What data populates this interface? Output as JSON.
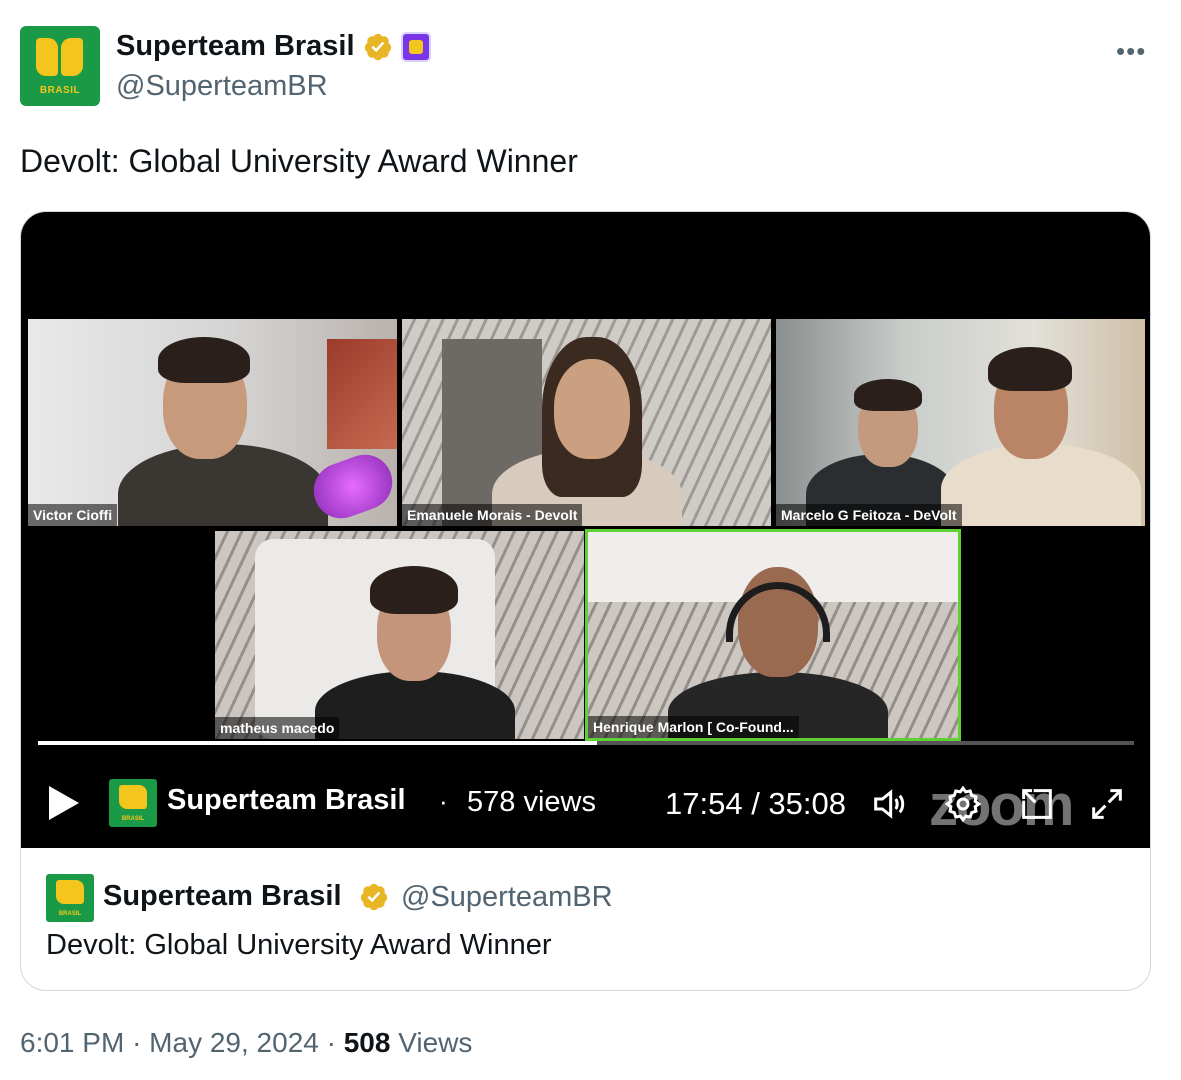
{
  "author": {
    "display_name": "Superteam Brasil",
    "handle": "@SuperteamBR",
    "avatar_text": "BRASIL",
    "verified_icon": "gold-verified-badge-icon",
    "affiliation_icon": "superteam-affiliate-badge-icon"
  },
  "tweet": {
    "text": "Devolt: Global University Award Winner"
  },
  "video": {
    "participants": [
      {
        "label": "Victor Cioffi"
      },
      {
        "label": "Emanuele Morais - Devolt"
      },
      {
        "label": "Marcelo G Feitoza - DeVolt"
      },
      {
        "label": "matheus macedo"
      },
      {
        "label": "Henrique Marlon [ Co-Found..."
      }
    ],
    "progress_fraction": 0.51,
    "channel_logo_text": "BRASIL",
    "channel_name": "Superteam Brasil",
    "separator": "·",
    "views": "578 views",
    "time": "17:54 / 35:08",
    "watermark": "zoom",
    "active_speaker_color": "#5fd134"
  },
  "quoted": {
    "logo_text": "BRASIL",
    "display_name": "Superteam Brasil",
    "handle": "@SuperteamBR",
    "text": "Devolt: Global University Award Winner"
  },
  "meta": {
    "time": "6:01 PM",
    "sep1": "·",
    "date": "May 29, 2024",
    "sep2": "·",
    "views_count": "508",
    "views_label": "Views"
  },
  "colors": {
    "brand_green": "#1a9a47",
    "brand_yellow": "#f4c51c",
    "verified_gold": "#e8b524",
    "secondary_text": "#536471"
  }
}
